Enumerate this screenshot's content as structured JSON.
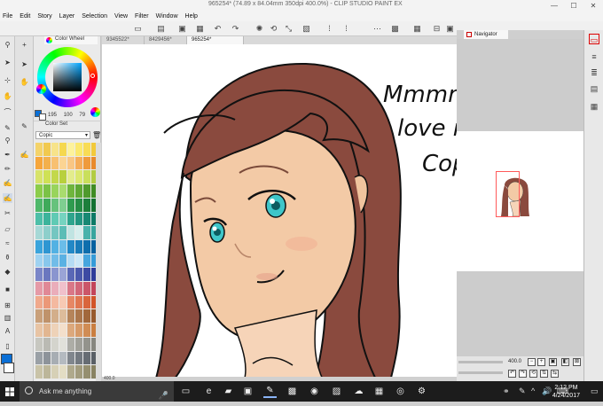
{
  "window": {
    "title": "965254* (74.89 x 84.04mm 350dpi 400.0%) - CLIP STUDIO PAINT EX",
    "minimize": "—",
    "maximize": "☐",
    "close": "✕"
  },
  "menu": [
    "File",
    "Edit",
    "Story",
    "Layer",
    "Selection",
    "View",
    "Filter",
    "Window",
    "Help"
  ],
  "colorWheel": {
    "tab_label": "Color Wheel",
    "h": "195",
    "s": "100",
    "v": "79",
    "main_color": "#0a6fd6",
    "sub_color": "#ffffff"
  },
  "colorSet": {
    "tab_label": "Color Set",
    "selected_set": "Copic"
  },
  "canvasTabs": [
    "9345522*",
    "8429456*",
    "965254*"
  ],
  "canvas": {
    "zoom_status": "400.0"
  },
  "navigator": {
    "tab_label": "Navigator",
    "zoom": "400.0"
  },
  "note": {
    "line1": "Mmmmm...",
    "line2": "love my new",
    "line3": "Copic pen~"
  },
  "taskbar": {
    "search_placeholder": "Ask me anything",
    "time": "2:12 PM",
    "date": "4/24/2017"
  },
  "colors": {
    "hair": "#8a4a3e",
    "skin": "#f3caa6",
    "eyes": "#3fc6c9",
    "accent": "#0a6fd6"
  },
  "icons": {
    "start": "windows-logo-icon",
    "search": "search-icon",
    "mic": "microphone-icon"
  }
}
